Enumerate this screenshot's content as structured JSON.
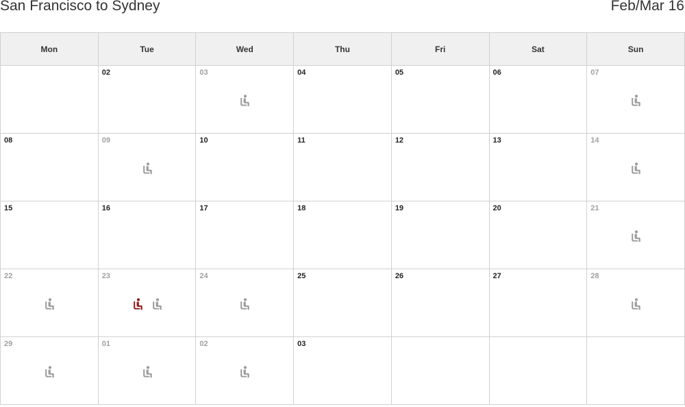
{
  "header": {
    "route": "San Francisco to Sydney",
    "month_label": "Feb/Mar 16"
  },
  "weekdays": [
    "Mon",
    "Tue",
    "Wed",
    "Thu",
    "Fri",
    "Sat",
    "Sun"
  ],
  "colors": {
    "available_seat": "#9a9a9a",
    "selected_seat": "#8b1a1a"
  },
  "weeks": [
    [
      {
        "day": "",
        "muted": false,
        "seats": []
      },
      {
        "day": "02",
        "muted": false,
        "seats": []
      },
      {
        "day": "03",
        "muted": true,
        "seats": [
          "available"
        ]
      },
      {
        "day": "04",
        "muted": false,
        "seats": []
      },
      {
        "day": "05",
        "muted": false,
        "seats": []
      },
      {
        "day": "06",
        "muted": false,
        "seats": []
      },
      {
        "day": "07",
        "muted": true,
        "seats": [
          "available"
        ]
      }
    ],
    [
      {
        "day": "08",
        "muted": false,
        "seats": []
      },
      {
        "day": "09",
        "muted": true,
        "seats": [
          "available"
        ]
      },
      {
        "day": "10",
        "muted": false,
        "seats": []
      },
      {
        "day": "11",
        "muted": false,
        "seats": []
      },
      {
        "day": "12",
        "muted": false,
        "seats": []
      },
      {
        "day": "13",
        "muted": false,
        "seats": []
      },
      {
        "day": "14",
        "muted": true,
        "seats": [
          "available"
        ]
      }
    ],
    [
      {
        "day": "15",
        "muted": false,
        "seats": []
      },
      {
        "day": "16",
        "muted": false,
        "seats": []
      },
      {
        "day": "17",
        "muted": false,
        "seats": []
      },
      {
        "day": "18",
        "muted": false,
        "seats": []
      },
      {
        "day": "19",
        "muted": false,
        "seats": []
      },
      {
        "day": "20",
        "muted": false,
        "seats": []
      },
      {
        "day": "21",
        "muted": true,
        "seats": [
          "available"
        ]
      }
    ],
    [
      {
        "day": "22",
        "muted": true,
        "seats": [
          "available"
        ]
      },
      {
        "day": "23",
        "muted": true,
        "seats": [
          "selected",
          "available"
        ]
      },
      {
        "day": "24",
        "muted": true,
        "seats": [
          "available"
        ]
      },
      {
        "day": "25",
        "muted": false,
        "seats": []
      },
      {
        "day": "26",
        "muted": false,
        "seats": []
      },
      {
        "day": "27",
        "muted": false,
        "seats": []
      },
      {
        "day": "28",
        "muted": true,
        "seats": [
          "available"
        ]
      }
    ],
    [
      {
        "day": "29",
        "muted": true,
        "seats": [
          "available"
        ]
      },
      {
        "day": "01",
        "muted": true,
        "seats": [
          "available"
        ]
      },
      {
        "day": "02",
        "muted": true,
        "seats": [
          "available"
        ]
      },
      {
        "day": "03",
        "muted": false,
        "seats": []
      },
      {
        "day": "",
        "muted": false,
        "seats": []
      },
      {
        "day": "",
        "muted": false,
        "seats": []
      },
      {
        "day": "",
        "muted": false,
        "seats": []
      }
    ]
  ]
}
